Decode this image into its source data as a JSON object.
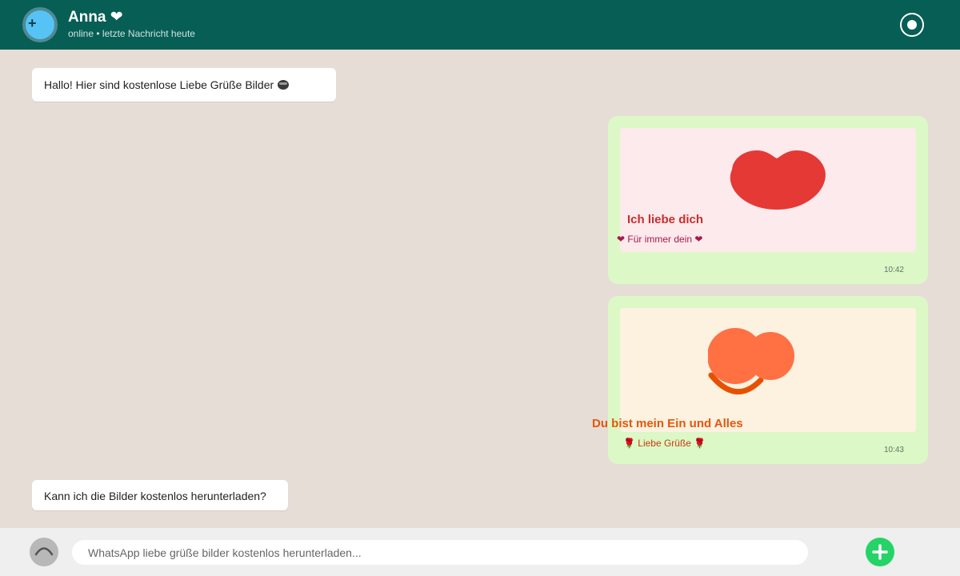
{
  "header": {
    "contact_name": "Anna ❤",
    "status_line": "online • letzte Nachricht heute",
    "avatar_glyph": "+"
  },
  "messages": [
    {
      "direction": "incoming",
      "text": "Hallo! Hier sind kostenlose Liebe Grüße Bilder",
      "emoji_icon": "cool-face-emoji"
    },
    {
      "direction": "outgoing",
      "image_card": {
        "title": "Ich liebe dich",
        "subtitle": "❤  Für immer dein ❤",
        "art_icon": "lips-icon",
        "background": "#fdeaec"
      },
      "time": "10:42"
    },
    {
      "direction": "outgoing",
      "image_card": {
        "title": "Du bist mein Ein und Alles",
        "subtitle": "🌹 Liebe Grüße 🌹",
        "art_icon": "sun-smile-icon",
        "background": "#fdf1e0"
      },
      "time": "10:43"
    },
    {
      "direction": "incoming",
      "text": "Kann ich die Bilder kostenlos herunterladen?"
    }
  ],
  "composer": {
    "placeholder": "WhatsApp liebe grüße bilder kostenlos herunterladen...",
    "value": "",
    "attach_icon": "arc-icon",
    "send_icon": "plus-icon"
  },
  "colors": {
    "header": "#075e55",
    "chat_background": "#e6ddd6",
    "outgoing_bubble": "#dcf8c6",
    "incoming_bubble": "#ffffff",
    "send_button": "#25d366",
    "lips": "#e53935",
    "sun": "#ff7043"
  }
}
